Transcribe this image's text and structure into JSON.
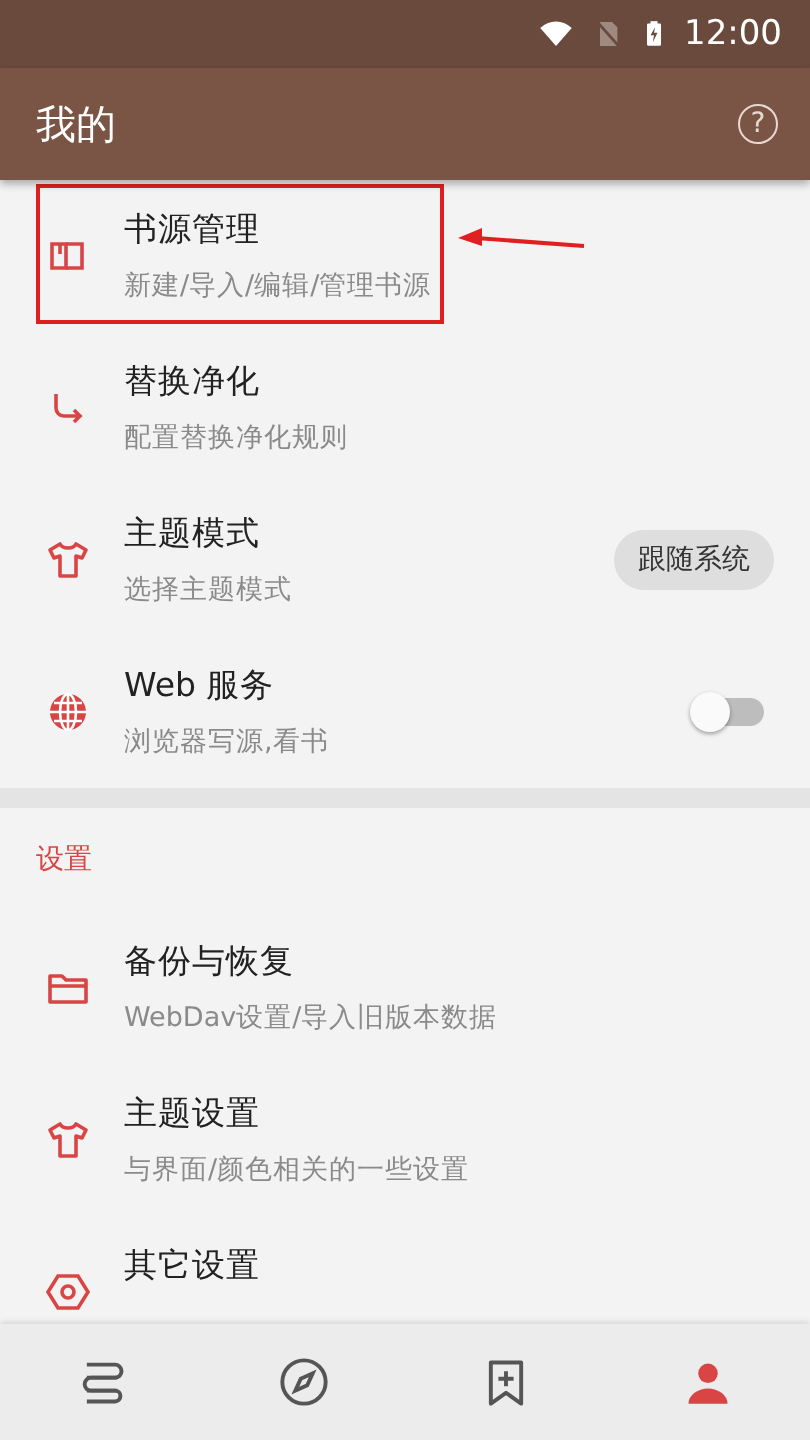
{
  "status_bar": {
    "time": "12:00"
  },
  "toolbar": {
    "title": "我的",
    "help": "?"
  },
  "sections": [
    {
      "items": [
        {
          "kind": "link",
          "title": "书源管理",
          "subtitle": "新建/导入/编辑/管理书源",
          "highlighted": true
        },
        {
          "kind": "link",
          "title": "替换净化",
          "subtitle": "配置替换净化规则",
          "highlighted": false
        },
        {
          "kind": "chip",
          "title": "主题模式",
          "subtitle": "选择主题模式",
          "value": "跟随系统",
          "highlighted": false
        },
        {
          "kind": "switch",
          "title": "Web 服务",
          "subtitle": "浏览器写源,看书",
          "on": false,
          "highlighted": false
        }
      ]
    },
    {
      "header": "设置",
      "items": [
        {
          "kind": "link",
          "title": "备份与恢复",
          "subtitle": "WebDav设置/导入旧版本数据",
          "highlighted": false
        },
        {
          "kind": "link",
          "title": "主题设置",
          "subtitle": "与界面/颜色相关的一些设置",
          "highlighted": false
        },
        {
          "kind": "link",
          "title": "其它设置",
          "highlighted": false
        }
      ]
    }
  ],
  "nav": [
    {
      "selected": false
    },
    {
      "selected": false
    },
    {
      "selected": false
    },
    {
      "selected": true
    }
  ]
}
